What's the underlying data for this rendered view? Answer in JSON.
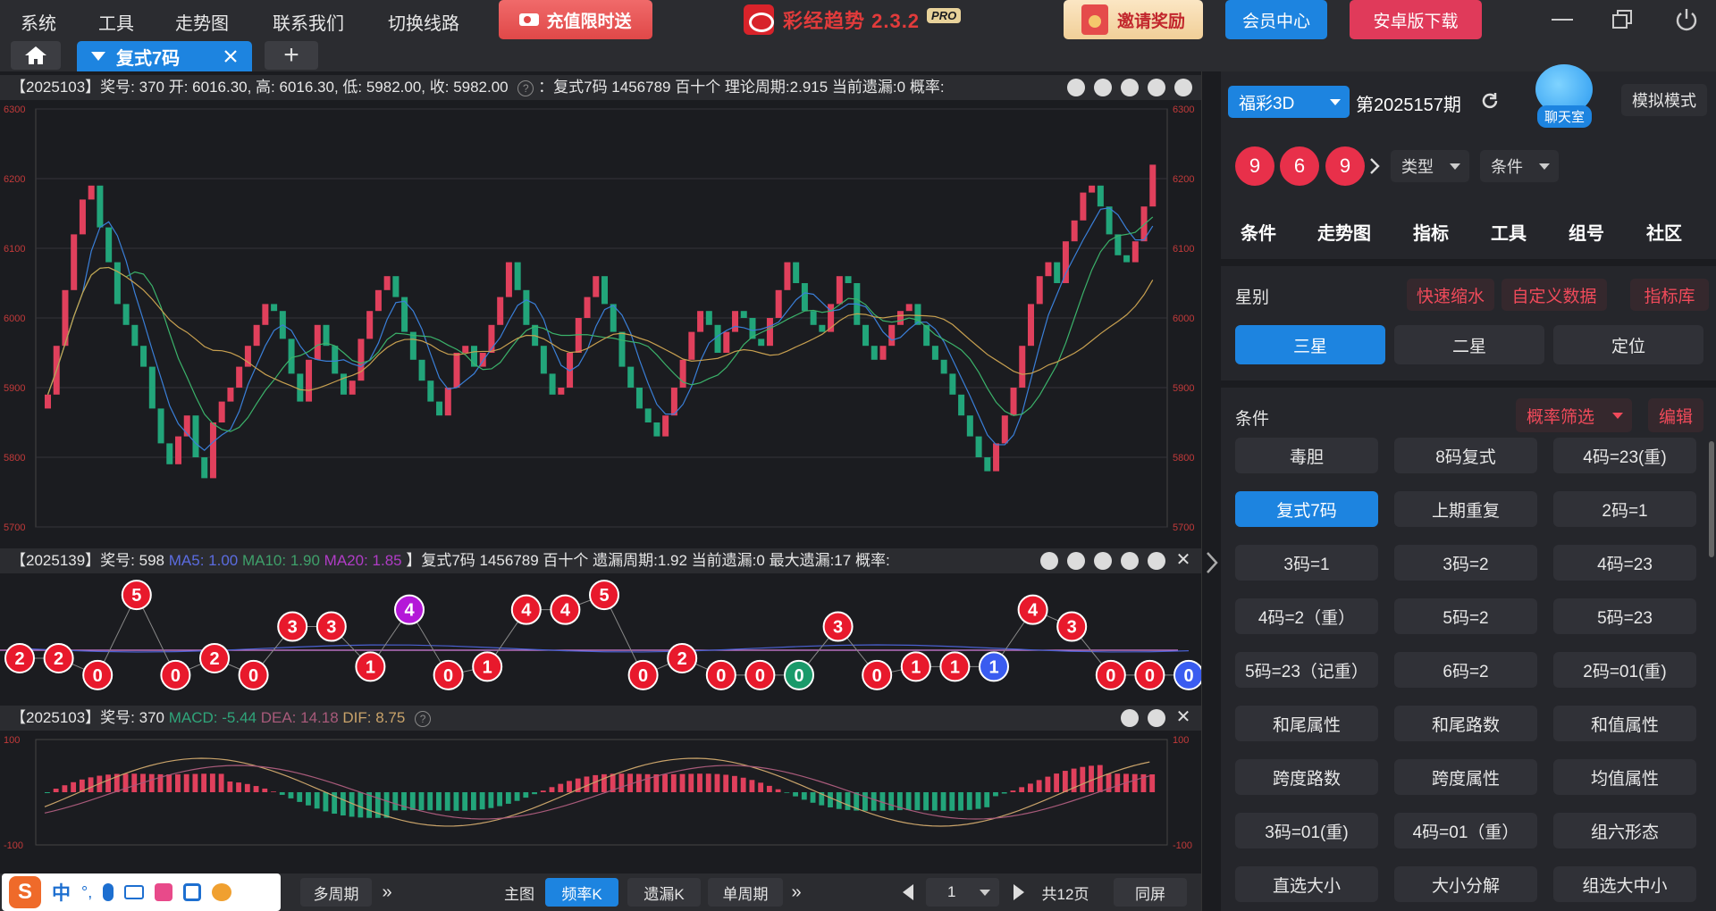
{
  "menu": {
    "items": [
      "系统",
      "工具",
      "走势图",
      "联系我们",
      "切换线路"
    ]
  },
  "promo": {
    "label": "充值限时送"
  },
  "app": {
    "name": "彩经趋势 2.3.2",
    "badge": "PRO"
  },
  "invite": {
    "label": "邀请奖励"
  },
  "member": {
    "label": "会员中心"
  },
  "android": {
    "label": "安卓版下载"
  },
  "tab": {
    "active_label": "复式7码",
    "add": "+"
  },
  "panel1": {
    "header": "【2025103】奖号: 370  开: 6016.30, 高: 6016.30, 低: 5982.00, 收: 5982.00",
    "header2": "：复式7码  1456789  百十个  理论周期:2.915  当前遗漏:0  概率:",
    "ylabels": [
      "6300",
      "6200",
      "6100",
      "6000",
      "5900",
      "5800",
      "5700"
    ]
  },
  "panel2": {
    "prefix": "【2025139】奖号: 598",
    "ma5": "MA5: 1.00",
    "ma10": "MA10: 1.90",
    "ma20": "MA20: 1.85",
    "rest": "】复式7码  1456789  百十个  遗漏周期:1.92  当前遗漏:0  最大遗漏:17  概率:",
    "balls": [
      {
        "v": "2",
        "c": "red",
        "y": 0.72
      },
      {
        "v": "2",
        "c": "red",
        "y": 0.72
      },
      {
        "v": "0",
        "c": "red",
        "y": 0.88
      },
      {
        "v": "5",
        "c": "red",
        "y": 0.12
      },
      {
        "v": "0",
        "c": "red",
        "y": 0.88
      },
      {
        "v": "2",
        "c": "red",
        "y": 0.72
      },
      {
        "v": "0",
        "c": "red",
        "y": 0.88
      },
      {
        "v": "3",
        "c": "red",
        "y": 0.42
      },
      {
        "v": "3",
        "c": "red",
        "y": 0.42
      },
      {
        "v": "1",
        "c": "red",
        "y": 0.8
      },
      {
        "v": "4",
        "c": "purple",
        "y": 0.26
      },
      {
        "v": "0",
        "c": "red",
        "y": 0.88
      },
      {
        "v": "1",
        "c": "red",
        "y": 0.8
      },
      {
        "v": "4",
        "c": "red",
        "y": 0.26
      },
      {
        "v": "4",
        "c": "red",
        "y": 0.26
      },
      {
        "v": "5",
        "c": "red",
        "y": 0.12
      },
      {
        "v": "0",
        "c": "red",
        "y": 0.88
      },
      {
        "v": "2",
        "c": "red",
        "y": 0.72
      },
      {
        "v": "0",
        "c": "red",
        "y": 0.88
      },
      {
        "v": "0",
        "c": "red",
        "y": 0.88
      },
      {
        "v": "0",
        "c": "green",
        "y": 0.88
      },
      {
        "v": "3",
        "c": "red",
        "y": 0.42
      },
      {
        "v": "0",
        "c": "red",
        "y": 0.88
      },
      {
        "v": "1",
        "c": "red",
        "y": 0.8
      },
      {
        "v": "1",
        "c": "red",
        "y": 0.8
      },
      {
        "v": "1",
        "c": "blue",
        "y": 0.8
      },
      {
        "v": "4",
        "c": "red",
        "y": 0.26
      },
      {
        "v": "3",
        "c": "red",
        "y": 0.42
      },
      {
        "v": "0",
        "c": "red",
        "y": 0.88
      },
      {
        "v": "0",
        "c": "red",
        "y": 0.88
      },
      {
        "v": "0",
        "c": "blue",
        "y": 0.88
      }
    ]
  },
  "panel3": {
    "prefix": "【2025103】奖号: 370",
    "macd": "MACD: -5.44",
    "dea": "DEA: 14.18",
    "dif": "DIF: 8.75",
    "ylabels": [
      "100",
      "-100"
    ]
  },
  "bottom": {
    "multi": "多周期",
    "main": "主图",
    "freq": "频率K",
    "miss": "遗漏K",
    "single": "单周期",
    "page": "1",
    "pages": "共12页",
    "sync": "同屏",
    "arrows": "»"
  },
  "right": {
    "lottery": "福彩3D",
    "period": "第2025157期",
    "chat": "聊天室",
    "mode": "模拟模式",
    "balls": [
      "9",
      "6",
      "9"
    ],
    "type": "类型",
    "cond": "条件",
    "tabs": [
      "条件",
      "走势图",
      "指标",
      "工具",
      "组号",
      "社区"
    ],
    "star_label": "星别",
    "links": [
      "快速缩水",
      "自定义数据",
      "指标库"
    ],
    "stars": [
      "三星",
      "二星",
      "定位"
    ],
    "cond_label": "条件",
    "filter": "概率筛选",
    "edit": "编辑",
    "grid": [
      [
        "毒胆",
        "8码复式",
        "4码=23(重)"
      ],
      [
        "复式7码",
        "上期重复",
        "2码=1"
      ],
      [
        "3码=1",
        "3码=2",
        "4码=23"
      ],
      [
        "4码=2（重）",
        "5码=2",
        "5码=23"
      ],
      [
        "5码=23（记重）",
        "6码=2",
        "2码=01(重)"
      ],
      [
        "和尾属性",
        "和尾路数",
        "和值属性"
      ],
      [
        "跨度路数",
        "跨度属性",
        "均值属性"
      ],
      [
        "3码=01(重)",
        "4码=01（重）",
        "组六形态"
      ],
      [
        "直选大小",
        "大小分解",
        "组选大中小"
      ]
    ]
  },
  "ime": {
    "lang": "中",
    "punct": "°,"
  }
}
